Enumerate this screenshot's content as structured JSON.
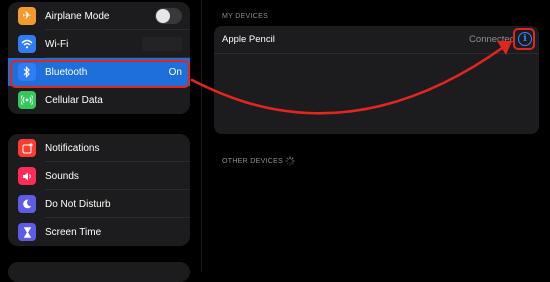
{
  "sidebar": {
    "group1": [
      {
        "label": "Airplane Mode",
        "icon": "airplane-icon",
        "color": "#f29a2e"
      },
      {
        "label": "Wi-Fi",
        "icon": "wifi-icon",
        "color": "#2f7cf6"
      },
      {
        "label": "Bluetooth",
        "icon": "bluetooth-icon",
        "color": "#2f7cf6",
        "value": "On"
      },
      {
        "label": "Cellular Data",
        "icon": "cellular-icon",
        "color": "#34c759"
      }
    ],
    "group2": [
      {
        "label": "Notifications",
        "icon": "notifications-icon",
        "color": "#ff3b30"
      },
      {
        "label": "Sounds",
        "icon": "sounds-icon",
        "color": "#ff2d55"
      },
      {
        "label": "Do Not Disturb",
        "icon": "moon-icon",
        "color": "#5e5ce6"
      },
      {
        "label": "Screen Time",
        "icon": "hourglass-icon",
        "color": "#5e5ce6"
      }
    ]
  },
  "main": {
    "my_devices_title": "MY DEVICES",
    "devices": [
      {
        "name": "Apple Pencil",
        "status": "Connected"
      }
    ],
    "other_devices_title": "OTHER DEVICES"
  },
  "colors": {
    "accent": "#2f8cff",
    "selected": "#1e6fd9",
    "highlight": "#e0261f"
  }
}
